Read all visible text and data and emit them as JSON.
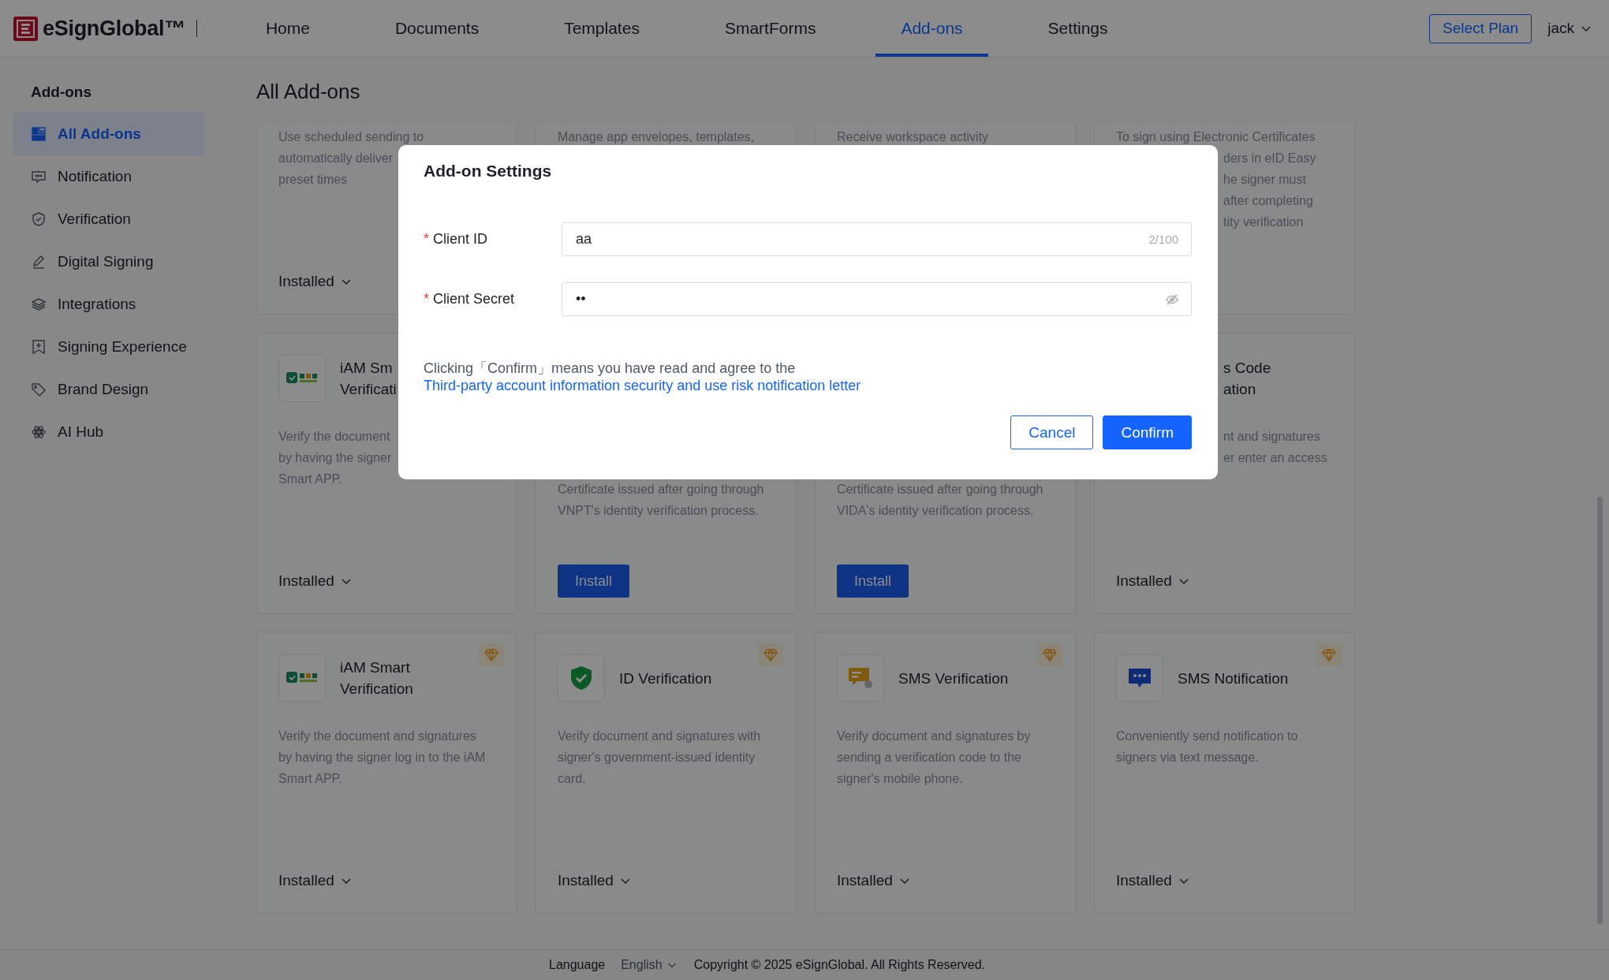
{
  "header": {
    "logo": "eSignGlobal™",
    "nav": [
      {
        "label": "Home",
        "selected": false
      },
      {
        "label": "Documents",
        "selected": false
      },
      {
        "label": "Templates",
        "selected": false
      },
      {
        "label": "SmartForms",
        "selected": false
      },
      {
        "label": "Add-ons",
        "selected": true
      },
      {
        "label": "Settings",
        "selected": false
      }
    ],
    "plan_button": "Select Plan",
    "user": "jack"
  },
  "sidebar": {
    "title": "Add-ons",
    "items": [
      {
        "label": "All Add-ons",
        "selected": true
      },
      {
        "label": "Notification",
        "selected": false
      },
      {
        "label": "Verification",
        "selected": false
      },
      {
        "label": "Digital Signing",
        "selected": false
      },
      {
        "label": "Integrations",
        "selected": false
      },
      {
        "label": "Signing Experience",
        "selected": false
      },
      {
        "label": "Brand Design",
        "selected": false
      },
      {
        "label": "AI Hub",
        "selected": false
      }
    ]
  },
  "page_title": "All Add-ons",
  "cards": [
    {
      "description": [
        "Use scheduled sending to",
        "automatically deliver\npreset times"
      ],
      "action": {
        "kind": "installed",
        "label": "Installed"
      }
    },
    {
      "description": [
        "Manage app envelopes, templates,"
      ]
    },
    {
      "description": [
        "Receive workspace activity"
      ]
    },
    {
      "description": [
        "To sign using Electronic Certificates",
        "ders in eID Easy\nhe signer must\nafter completing\ntity verification"
      ]
    },
    {
      "title": "iAM Sm\nVerificati",
      "description": [
        "Verify the document\nby having the signer\nSmart APP."
      ],
      "action": {
        "kind": "installed",
        "label": "Installed"
      }
    },
    {
      "description": [
        "Certificate issued after going through\nVNPT's identity verification process."
      ],
      "action": {
        "kind": "install",
        "label": "Install"
      }
    },
    {
      "description": [
        "Certificate issued after going through\nVIDA's identity verification process."
      ],
      "action": {
        "kind": "install",
        "label": "Install"
      }
    },
    {
      "title": "s Code\nation",
      "description": [
        "nt and signatures\ner enter an access"
      ],
      "action": {
        "kind": "installed",
        "label": "Installed"
      }
    },
    {
      "title": "iAM Smart\nVerification",
      "premium": true,
      "description": [
        "Verify the document and signatures\nby having the signer log in to the iAM\nSmart APP."
      ],
      "action": {
        "kind": "installed",
        "label": "Installed"
      }
    },
    {
      "title": "ID Verification",
      "premium": true,
      "description": [
        "Verify document and signatures with\nsigner's government-issued identity\ncard."
      ],
      "action": {
        "kind": "installed",
        "label": "Installed"
      }
    },
    {
      "title": "SMS Verification",
      "premium": true,
      "description": [
        "Verify document and signatures by\nsending a verification code to the\nsigner's mobile phone."
      ],
      "action": {
        "kind": "installed",
        "label": "Installed"
      }
    },
    {
      "title": "SMS Notification",
      "premium": true,
      "description": [
        "Conveniently send notification to\nsigners via text message."
      ],
      "action": {
        "kind": "installed",
        "label": "Installed"
      }
    }
  ],
  "dialog": {
    "title": "Add-on Settings",
    "fields": [
      {
        "required_mark": "*",
        "label": "Client ID",
        "kind": "text",
        "value": "aa",
        "counter": "2/100"
      },
      {
        "required_mark": "*",
        "label": "Client Secret",
        "kind": "password",
        "value": "••"
      }
    ],
    "notice": "Clicking「Confirm」means you have read and agree to the ",
    "notice_link": "Third-party account information security and use risk notification letter",
    "buttons": [
      {
        "label": "Cancel",
        "kind": "secondary"
      },
      {
        "label": "Confirm",
        "kind": "primary"
      }
    ]
  },
  "footer": {
    "language_label": "Language",
    "language": "English",
    "copyright": "Copyright © 2025 eSignGlobal. All Rights Reserved."
  }
}
